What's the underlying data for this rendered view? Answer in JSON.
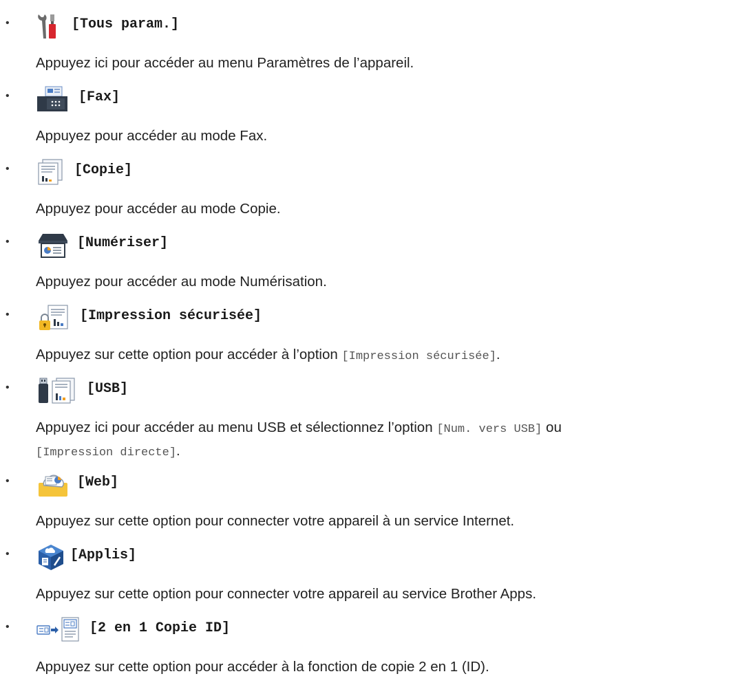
{
  "items": [
    {
      "icon": "tools-icon",
      "title": "[Tous param.]",
      "description": "Appuyez ici pour accéder au menu Paramètres de l’appareil."
    },
    {
      "icon": "fax-icon",
      "title": "[Fax]",
      "description": "Appuyez pour accéder au mode Fax."
    },
    {
      "icon": "copy-icon",
      "title": "[Copie]",
      "description": "Appuyez pour accéder au mode Copie."
    },
    {
      "icon": "scanner-icon",
      "title": "[Numériser]",
      "description": "Appuyez pour accéder au mode Numérisation."
    },
    {
      "icon": "secure-print-icon",
      "title": "[Impression sécurisée]",
      "description_pre": "Appuyez sur cette option pour accéder à l’option ",
      "description_code": "[Impression sécurisée]",
      "description_post": "."
    },
    {
      "icon": "usb-icon",
      "title": "[USB]",
      "description_pre": "Appuyez ici pour accéder au menu USB et sélectionnez l’option ",
      "description_code1": "[Num. vers USB]",
      "description_mid": " ou",
      "description_code2": "[Impression directe]",
      "description_post": "."
    },
    {
      "icon": "web-cloud-icon",
      "title": "[Web]",
      "description": "Appuyez sur cette option pour connecter votre appareil à un service Internet."
    },
    {
      "icon": "apps-cube-icon",
      "title": "[Applis]",
      "description": "Appuyez sur cette option pour connecter votre appareil au service Brother Apps."
    },
    {
      "icon": "id-copy-icon",
      "title": "[2 en 1 Copie ID]",
      "description": "Appuyez sur cette option pour accéder à la fonction de copie 2 en 1 (ID)."
    }
  ],
  "bullet": "•"
}
